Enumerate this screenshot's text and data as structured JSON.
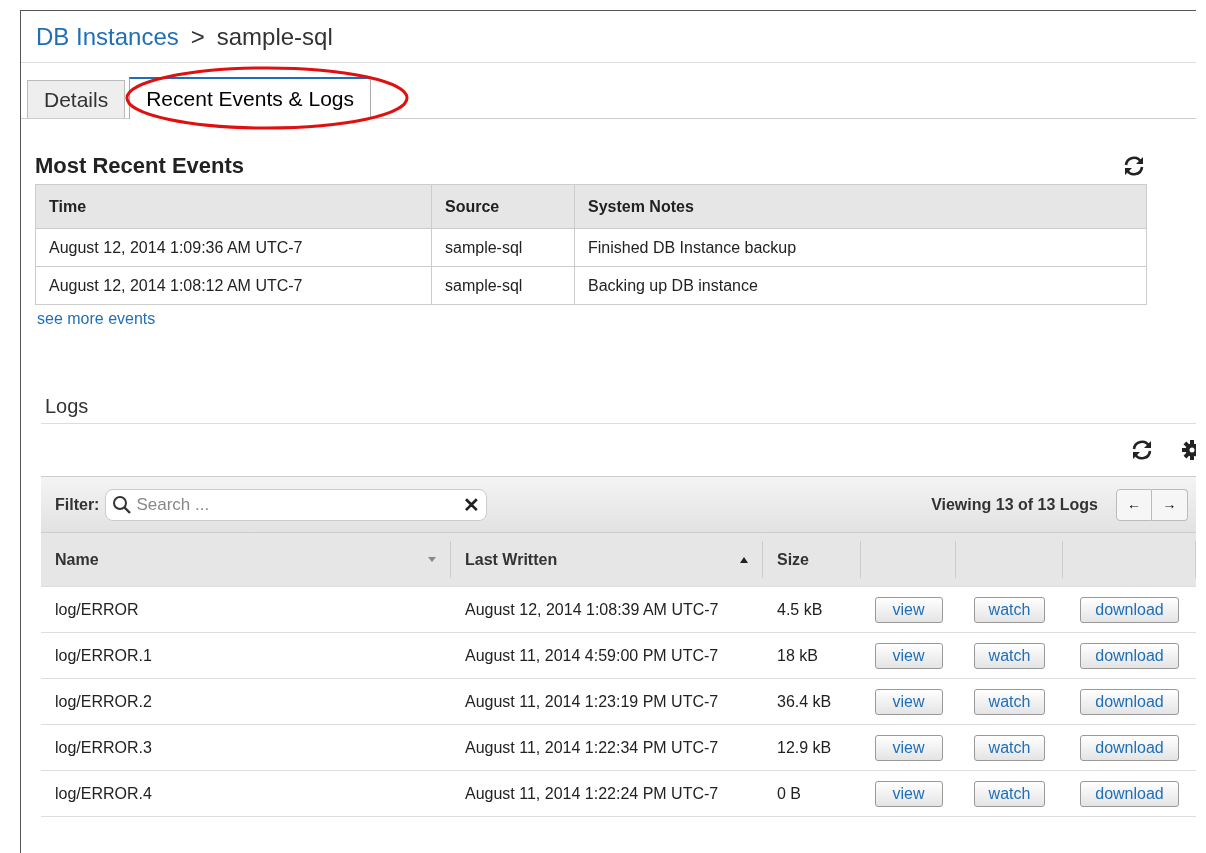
{
  "breadcrumb": {
    "parent": "DB Instances",
    "separator": ">",
    "current": "sample-sql"
  },
  "tabs": [
    {
      "label": "Details",
      "selected": false
    },
    {
      "label": "Recent Events & Logs",
      "selected": true
    }
  ],
  "events": {
    "title": "Most Recent Events",
    "columns": [
      "Time",
      "Source",
      "System Notes"
    ],
    "rows": [
      [
        "August 12, 2014 1:09:36 AM UTC-7",
        "sample-sql",
        "Finished DB Instance backup"
      ],
      [
        "August 12, 2014 1:08:12 AM UTC-7",
        "sample-sql",
        "Backing up DB instance"
      ]
    ],
    "more_link": "see more events"
  },
  "logs": {
    "title": "Logs",
    "filter_label": "Filter:",
    "search": {
      "placeholder": "Search ..."
    },
    "clear": "✕",
    "viewing": "Viewing 13 of 13 Logs",
    "prev": "←",
    "next": "→",
    "columns": [
      {
        "label": "Name",
        "sorted": false
      },
      {
        "label": "Last Written",
        "sorted": true
      },
      {
        "label": "Size"
      }
    ],
    "rows": [
      {
        "name": "log/ERROR",
        "written": "August 12, 2014 1:08:39 AM UTC-7",
        "size": "4.5 kB",
        "actions": [
          "view",
          "watch",
          "download"
        ]
      },
      {
        "name": "log/ERROR.1",
        "written": "August 11, 2014 4:59:00 PM UTC-7",
        "size": "18 kB",
        "actions": [
          "view",
          "watch",
          "download"
        ]
      },
      {
        "name": "log/ERROR.2",
        "written": "August 11, 2014 1:23:19 PM UTC-7",
        "size": "36.4 kB",
        "actions": [
          "view",
          "watch",
          "download"
        ]
      },
      {
        "name": "log/ERROR.3",
        "written": "August 11, 2014 1:22:34 PM UTC-7",
        "size": "12.9 kB",
        "actions": [
          "view",
          "watch",
          "download"
        ]
      },
      {
        "name": "log/ERROR.4",
        "written": "August 11, 2014 1:22:24 PM UTC-7",
        "size": "0 B",
        "actions": [
          "view",
          "watch",
          "download"
        ]
      }
    ]
  }
}
